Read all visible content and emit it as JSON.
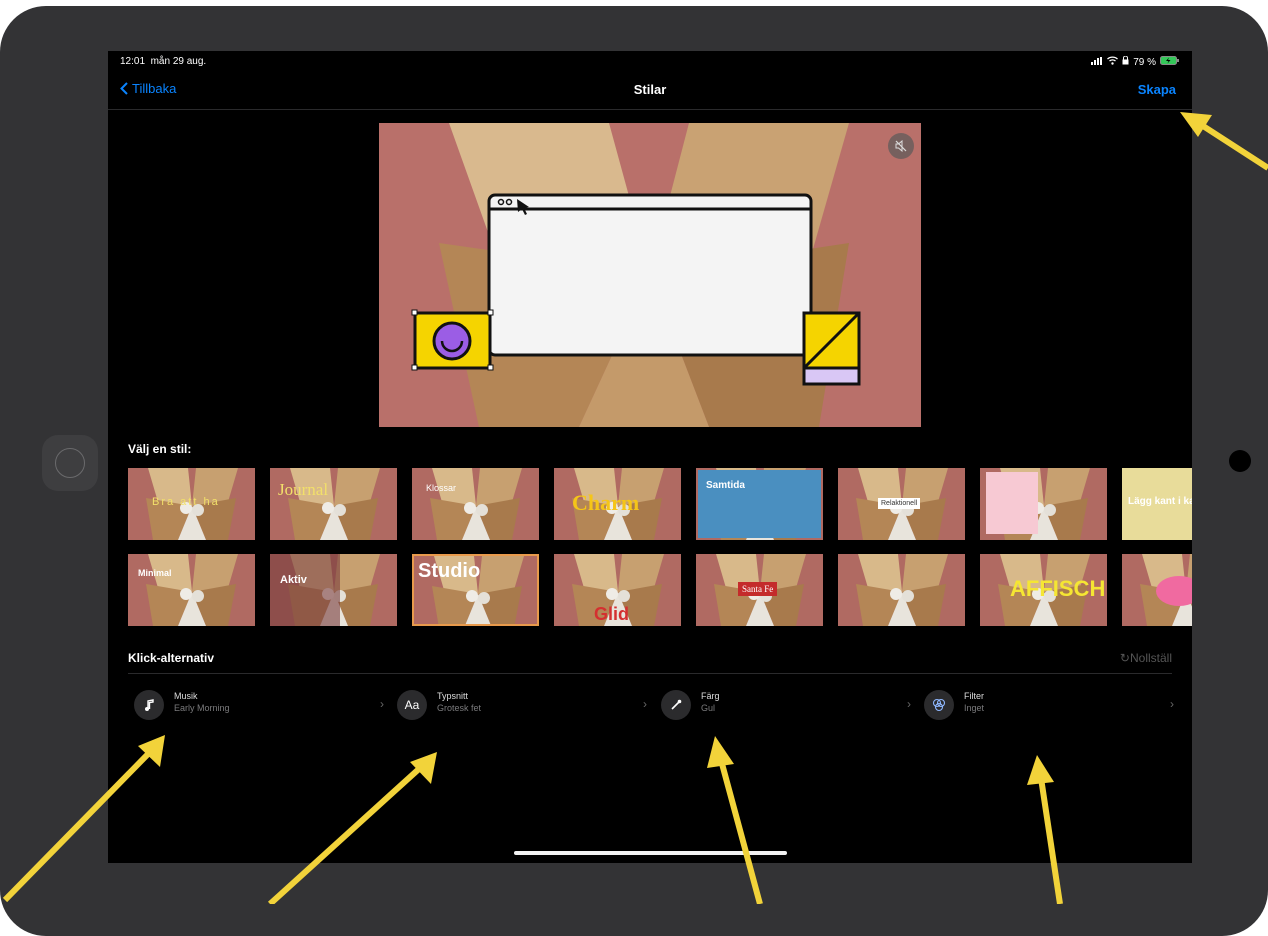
{
  "status_bar": {
    "time": "12:01",
    "date": "mån 29 aug.",
    "battery": "79 %"
  },
  "nav": {
    "back_label": "Tillbaka",
    "title": "Stilar",
    "create_label": "Skapa"
  },
  "styles": {
    "heading": "Välj en stil:",
    "row1": [
      {
        "label": "Bra att ha"
      },
      {
        "label": "Journal"
      },
      {
        "label": "Klossar"
      },
      {
        "label": "Charm"
      },
      {
        "label": "Samtida"
      },
      {
        "label": "Relaktionell"
      },
      {
        "label": ""
      },
      {
        "label": "Lägg kant i kant"
      }
    ],
    "row2": [
      {
        "label": "Minimal"
      },
      {
        "label": "Aktiv"
      },
      {
        "label": "Studio"
      },
      {
        "label": "Glid"
      },
      {
        "label": "Santa Fe"
      },
      {
        "label": ""
      },
      {
        "label": "AFFISCH"
      },
      {
        "label": ""
      }
    ]
  },
  "click_options": {
    "heading": "Klick-alternativ",
    "reset_label": "Nollställ",
    "items": [
      {
        "name": "Musik",
        "value": "Early Morning",
        "icon": "music-note-icon"
      },
      {
        "name": "Typsnitt",
        "value": "Grotesk fet",
        "icon": "font-icon"
      },
      {
        "name": "Färg",
        "value": "Gul",
        "icon": "eyedropper-icon"
      },
      {
        "name": "Filter",
        "value": "Inget",
        "icon": "filter-icon"
      }
    ]
  },
  "colors": {
    "accent": "#0a84ff",
    "arrow": "#f2d33a",
    "preview_bg": "#b9706a",
    "selected_border": "#e89a4c"
  }
}
